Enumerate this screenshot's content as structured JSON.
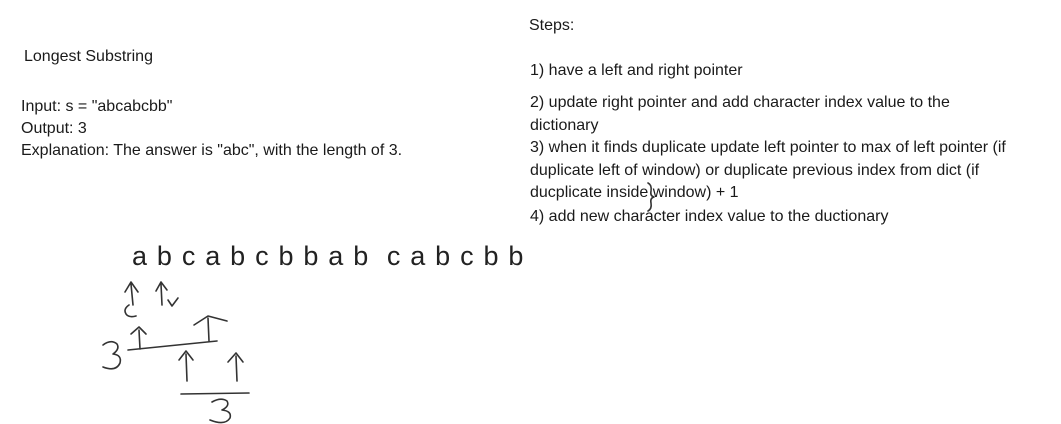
{
  "problem": {
    "title": "Longest Substring",
    "input": "Input: s = \"abcabcbb\"",
    "output": "Output: 3",
    "explanation": "Explanation: The answer is \"abc\", with the length of 3."
  },
  "steps": {
    "heading": "Steps:",
    "step1": "1) have a left and right pointer",
    "step2_line1": "2) update right pointer and add character index value to the",
    "step2_line2": "dictionary",
    "step3_line1": "3) when it finds duplicate update left pointer to max of left pointer (if",
    "step3_line2": "duplicate left of window) or duplicate previous index from dict (if",
    "step3_line3": "ducplicate inside window) + 1",
    "step4": "4) add new character index value to the ductionary"
  },
  "sketch": {
    "sequence": "a b c a b c b b a b  c a b c b b",
    "count_first": "3",
    "count_second": "3"
  }
}
